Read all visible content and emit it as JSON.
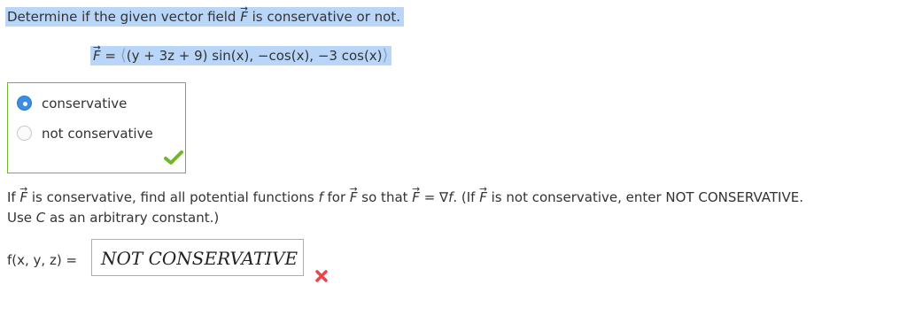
{
  "question": {
    "text_before": "Determine if the given vector field ",
    "vector": "F",
    "text_after": " is conservative or not."
  },
  "formula": {
    "lhs": "F",
    "equals": " = ",
    "open": "⟨",
    "components": "(y + 3z + 9) sin(x), −cos(x), −3 cos(x)",
    "close": "⟩"
  },
  "choices": [
    {
      "label": "conservative",
      "selected": true
    },
    {
      "label": "not conservative",
      "selected": false
    }
  ],
  "choice_feedback": "check-icon",
  "prompt": {
    "p1": "If ",
    "v1": "F",
    "p2": " is conservative, find all potential functions ",
    "f1": "f",
    "p3": " for ",
    "v2": "F",
    "p4": " so that ",
    "v3": "F",
    "p5": " = ∇",
    "f2": "f",
    "p6": ". (If ",
    "v4": "F",
    "p7": " is not conservative, enter NOT CONSERVATIVE.",
    "p8": "Use ",
    "c": "C",
    "p9": " as an arbitrary constant.)"
  },
  "answer": {
    "label": "f(x, y, z) = ",
    "value": "NOT CONSERVATIVE"
  },
  "answer_feedback": "x-mark-icon",
  "colors": {
    "highlight": "#b9d6f8",
    "selected_radio": "#3a8ee6",
    "correct_green": "#73b52b",
    "incorrect_red": "#e8464b"
  }
}
